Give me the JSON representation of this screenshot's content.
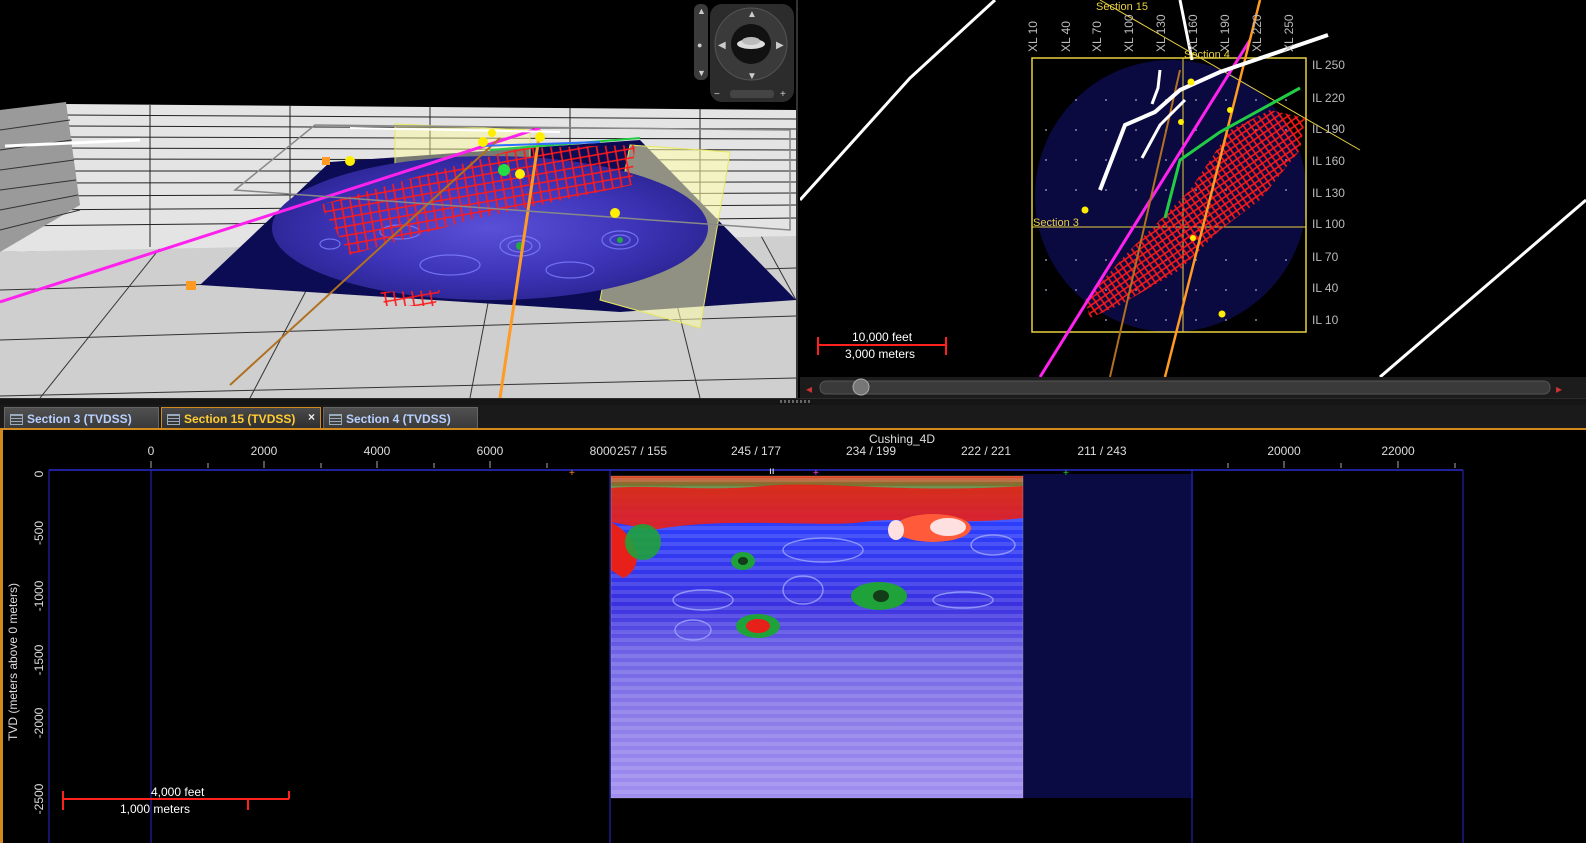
{
  "view3d": {
    "name": "3D view",
    "colors": {
      "horizon": "#3a2a9c",
      "faults": "#ff2020",
      "well_magenta": "#ff22ee",
      "well_orange": "#ff9a22",
      "well_brown": "#b07020",
      "marker": "#ffee00"
    }
  },
  "navigator": {
    "icons": [
      "pan-up-icon",
      "pan-left-icon",
      "pan-right-icon",
      "pan-down-icon",
      "zoom-in-icon",
      "zoom-out-icon"
    ]
  },
  "basemap": {
    "xl_labels": [
      "XL 10",
      "XL 40",
      "XL 70",
      "XL 100",
      "XL 130",
      "XL 160",
      "XL 190",
      "XL 220",
      "XL 250"
    ],
    "il_labels": [
      "IL 250",
      "IL 220",
      "IL 190",
      "IL 160",
      "IL 130",
      "IL 100",
      "IL 70",
      "IL 40",
      "IL 10"
    ],
    "section_labels": {
      "section15": "Section 15",
      "section4": "Section 4",
      "section3": "Section 3"
    },
    "scale": {
      "feet": "10,000 feet",
      "meters": "3,000 meters"
    },
    "scroll_left": "◂",
    "scroll_right": "▸"
  },
  "tabs": [
    {
      "label": "Section 3 (TVDSS)",
      "active": false
    },
    {
      "label": "Section 15 (TVDSS)",
      "active": true,
      "close": "×"
    },
    {
      "label": "Section 4 (TVDSS)",
      "active": false
    }
  ],
  "section": {
    "volume_label": "Cushing_4D",
    "x_ticks": [
      "0",
      "2000",
      "4000",
      "6000",
      "8000",
      "20000",
      "22000"
    ],
    "trace_labels": [
      "257 / 155",
      "245 / 177",
      "234 / 199",
      "222 / 221",
      "211 / 243"
    ],
    "y_ticks": [
      "0",
      "-500",
      "-1000",
      "-1500",
      "-2000",
      "-2500"
    ],
    "y_axis_label": "TVD (meters above 0 meters)",
    "scale": {
      "feet": "4,000 feet",
      "meters": "1,000 meters"
    },
    "colors": {
      "high": "#e81010",
      "mid": "#1fa23a",
      "low": "#2a30e0",
      "base": "#8a78e6"
    }
  }
}
